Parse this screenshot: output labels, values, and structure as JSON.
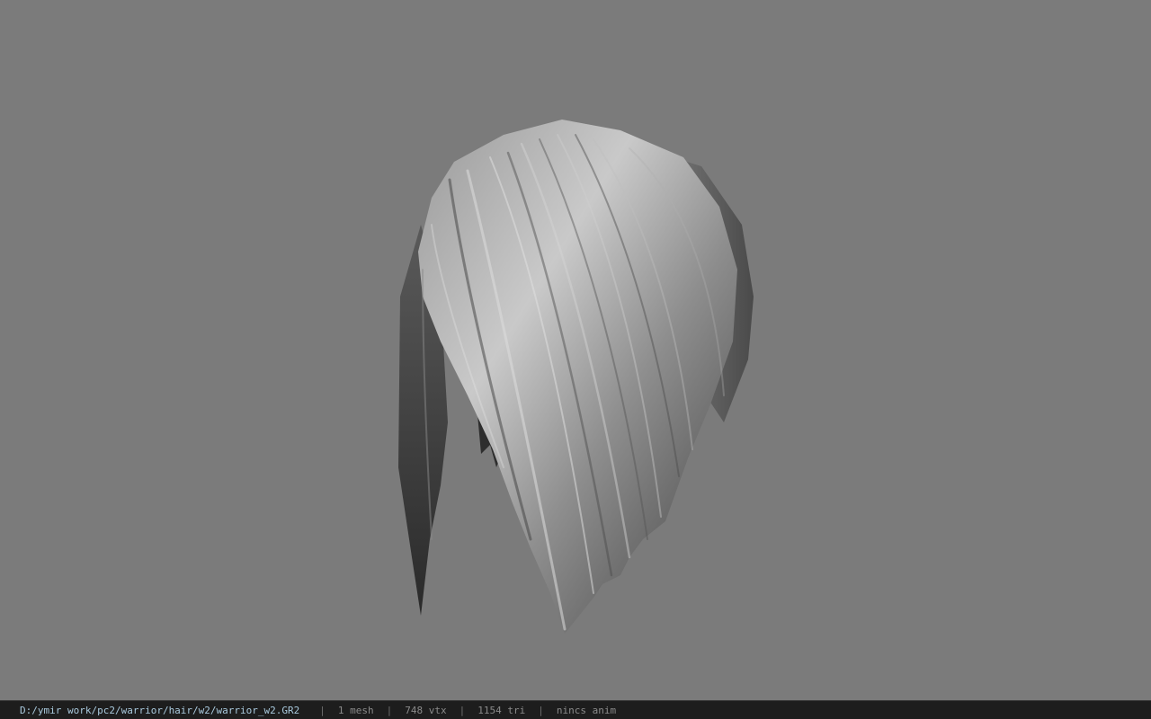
{
  "viewer": {
    "background_color": "#7b7b7b",
    "model_name": "hair-mesh"
  },
  "statusbar": {
    "file_path": "D:/ymir work/pc2/warrior/hair/w2/warrior_w2.GR2",
    "separator": "|",
    "mesh_count": "1 mesh",
    "vertex_count": "748 vtx",
    "triangle_count": "1154 tri",
    "anim_status": "nincs anim"
  }
}
